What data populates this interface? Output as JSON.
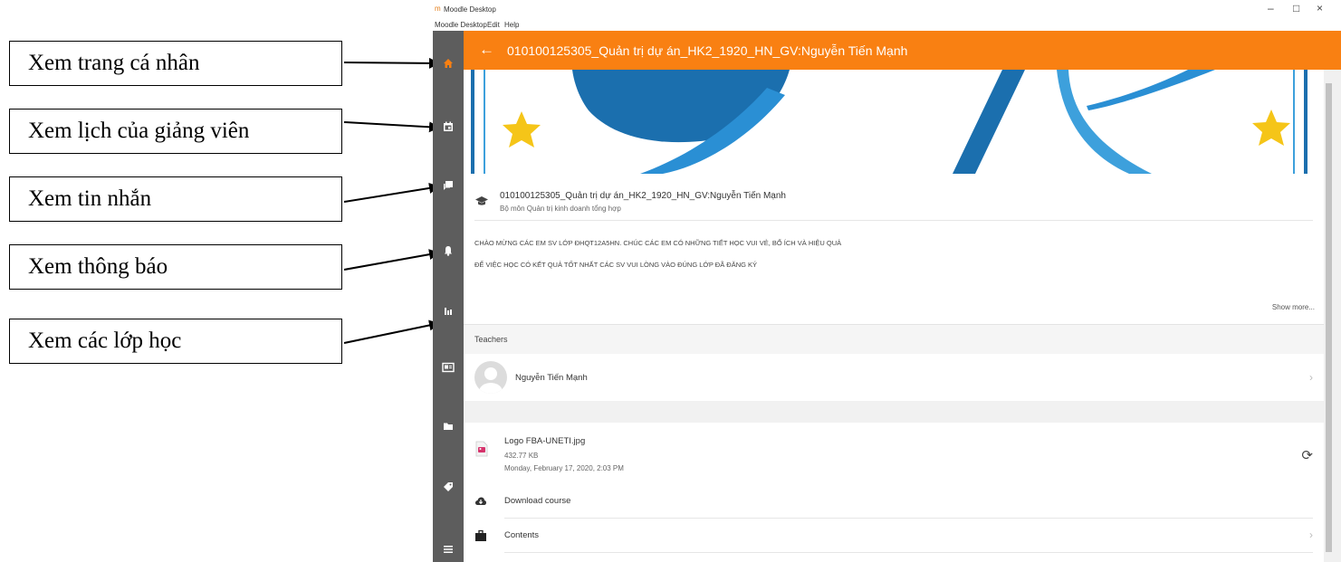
{
  "callouts": [
    "Xem trang cá nhân",
    "Xem lịch của giảng viên",
    "Xem tin nhắn",
    "Xem thông báo",
    "Xem các lớp học"
  ],
  "window": {
    "title": "Moodle Desktop",
    "menu": [
      "Moodle Desktop",
      "Edit",
      "Help"
    ],
    "controls": [
      "–",
      "□",
      "×"
    ]
  },
  "sidebar_icons": [
    "home-icon",
    "calendar-icon",
    "messages-icon",
    "notifications-icon",
    "grades-icon",
    "badge-icon",
    "folder-icon",
    "tag-icon",
    "menu-icon"
  ],
  "header": {
    "back_icon": "←",
    "title": "010100125305_Quản trị dự án_HK2_1920_HN_GV:Nguyễn Tiến Mạnh"
  },
  "course": {
    "name": "010100125305_Quản trị dự án_HK2_1920_HN_GV:Nguyễn Tiến Mạnh",
    "department": "Bộ môn Quản trị kinh doanh tổng hợp",
    "summary_line1": "CHÀO MỪNG CÁC EM SV LỚP ĐHQT12A5HN. CHÚC CÁC EM CÓ NHỮNG TIẾT HỌC VUI VẺ, BỔ ÍCH VÀ HIỆU QUẢ",
    "summary_line2": "ĐỂ VIỆC HỌC CÓ KẾT QUẢ TỐT NHẤT CÁC SV VUI LÒNG VÀO ĐÚNG LỚP ĐÃ ĐĂNG KÝ",
    "show_more": "Show more..."
  },
  "teachers": {
    "heading": "Teachers",
    "items": [
      {
        "name": "Nguyễn Tiến Mạnh"
      }
    ]
  },
  "file": {
    "name": "Logo FBA-UNETI.jpg",
    "size": "432.77 KB",
    "date": "Monday, February 17, 2020, 2:03 PM"
  },
  "actions": {
    "download_course": "Download course",
    "contents": "Contents"
  },
  "colors": {
    "header": "#f98012",
    "sidebar": "#5d5d5d",
    "active_icon": "#f98012",
    "banner_blue": "#1b6fae",
    "banner_star": "#f5c518"
  }
}
